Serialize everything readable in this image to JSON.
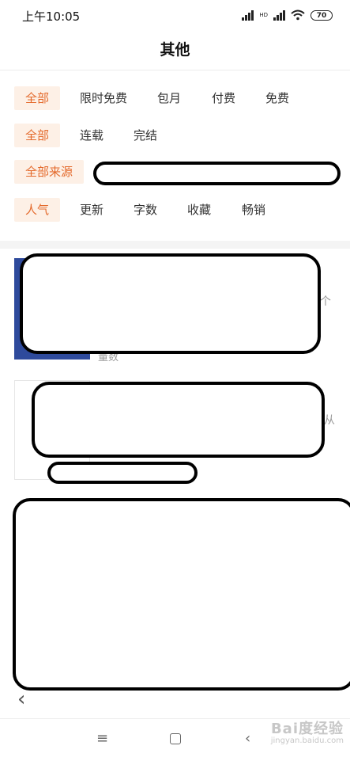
{
  "status_bar": {
    "time": "上午10:05",
    "network": "HD",
    "battery": "70"
  },
  "header": {
    "title": "其他"
  },
  "filters": {
    "price": [
      "全部",
      "限时免费",
      "包月",
      "付费",
      "免费"
    ],
    "status": [
      "全部",
      "连载",
      "完结"
    ],
    "source": [
      "全部来源"
    ],
    "sort": [
      "人气",
      "更新",
      "字数",
      "收藏",
      "畅销"
    ]
  },
  "list_peeks": [
    "个",
    "量数",
    "从"
  ],
  "watermark": {
    "brand": "Bai度经验",
    "url": "jingyan.baidu.com"
  },
  "colors": {
    "accent": "#e46a2c",
    "chip_bg": "#fdf0e6",
    "cover_blue": "#2e4a9c"
  },
  "icons": [
    "signal-icon",
    "wifi-icon",
    "battery-icon",
    "back-arrow-icon",
    "menu-icon",
    "home-icon",
    "back-nav-icon"
  ]
}
